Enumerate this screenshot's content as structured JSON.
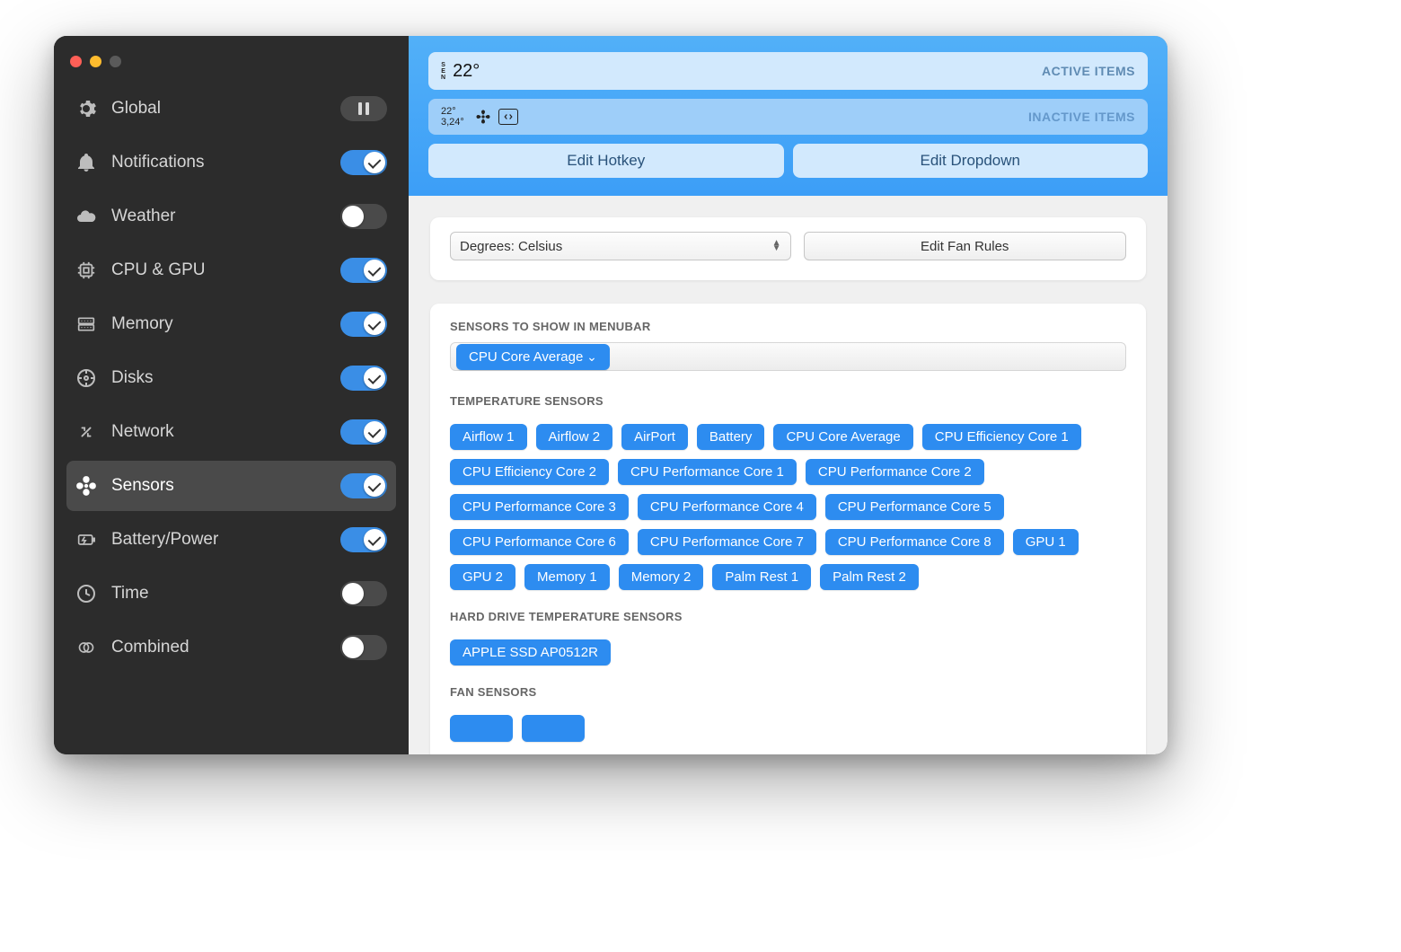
{
  "sidebar": {
    "items": [
      {
        "label": "Global"
      },
      {
        "label": "Notifications"
      },
      {
        "label": "Weather"
      },
      {
        "label": "CPU & GPU"
      },
      {
        "label": "Memory"
      },
      {
        "label": "Disks"
      },
      {
        "label": "Network"
      },
      {
        "label": "Sensors"
      },
      {
        "label": "Battery/Power"
      },
      {
        "label": "Time"
      },
      {
        "label": "Combined"
      }
    ]
  },
  "header": {
    "active_label": "ACTIVE ITEMS",
    "inactive_label": "INACTIVE ITEMS",
    "sen_badge_top": "S",
    "sen_badge_mid": "E",
    "sen_badge_bot": "N",
    "temp": "22°",
    "mini_temp1": "22°",
    "mini_temp2": "3,24°",
    "edit_hotkey": "Edit Hotkey",
    "edit_dropdown": "Edit Dropdown"
  },
  "settings": {
    "degrees_label": "Degrees: Celsius",
    "edit_fan_rules": "Edit Fan Rules",
    "menubar_title": "SENSORS TO SHOW IN MENUBAR",
    "menubar_chip": "CPU Core Average",
    "temp_title": "TEMPERATURE SENSORS",
    "temp_sensors": [
      "Airflow 1",
      "Airflow 2",
      "AirPort",
      "Battery",
      "CPU Core Average",
      "CPU Efficiency Core 1",
      "CPU Efficiency Core 2",
      "CPU Performance Core 1",
      "CPU Performance Core 2",
      "CPU Performance Core 3",
      "CPU Performance Core 4",
      "CPU Performance Core 5",
      "CPU Performance Core 6",
      "CPU Performance Core 7",
      "CPU Performance Core 8",
      "GPU 1",
      "GPU 2",
      "Memory 1",
      "Memory 2",
      "Palm Rest 1",
      "Palm Rest 2"
    ],
    "hdd_title": "HARD DRIVE TEMPERATURE SENSORS",
    "hdd_sensors": [
      "APPLE SSD AP0512R"
    ],
    "fan_title": "FAN SENSORS"
  }
}
